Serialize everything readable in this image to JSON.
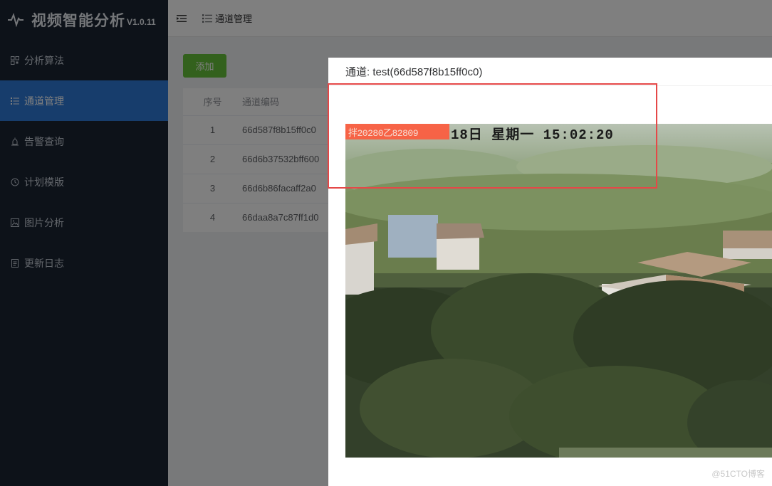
{
  "app": {
    "title": "视频智能分析",
    "version": "V1.0.11"
  },
  "sidebar": {
    "items": [
      {
        "label": "分析算法",
        "icon": "qrcode-icon"
      },
      {
        "label": "通道管理",
        "icon": "list-icon",
        "active": true
      },
      {
        "label": "告警查询",
        "icon": "alarm-icon"
      },
      {
        "label": "计划模版",
        "icon": "clock-icon"
      },
      {
        "label": "图片分析",
        "icon": "image-icon"
      },
      {
        "label": "更新日志",
        "icon": "document-icon"
      }
    ]
  },
  "header": {
    "breadcrumb": "通道管理"
  },
  "toolbar": {
    "add_label": "添加"
  },
  "table": {
    "columns": [
      "序号",
      "通道编码"
    ],
    "rows": [
      {
        "index": "1",
        "code": "66d587f8b15ff0c0"
      },
      {
        "index": "2",
        "code": "66d6b37532bff600"
      },
      {
        "index": "3",
        "code": "66d6b86facaff2a0"
      },
      {
        "index": "4",
        "code": "66daa8a7c87ff1d0"
      }
    ]
  },
  "dialog": {
    "title": "通道: test(66d587f8b15ff0c0)",
    "video": {
      "osd_red_text": "拌20280乙82809",
      "osd_text": "18日 星期一 15:02:20"
    }
  },
  "watermark": "@51CTO博客",
  "colors": {
    "sidebar_bg": "#1b2433",
    "active": "#2f7bd8",
    "add_button": "#67c23a",
    "highlight": "#e54848"
  }
}
